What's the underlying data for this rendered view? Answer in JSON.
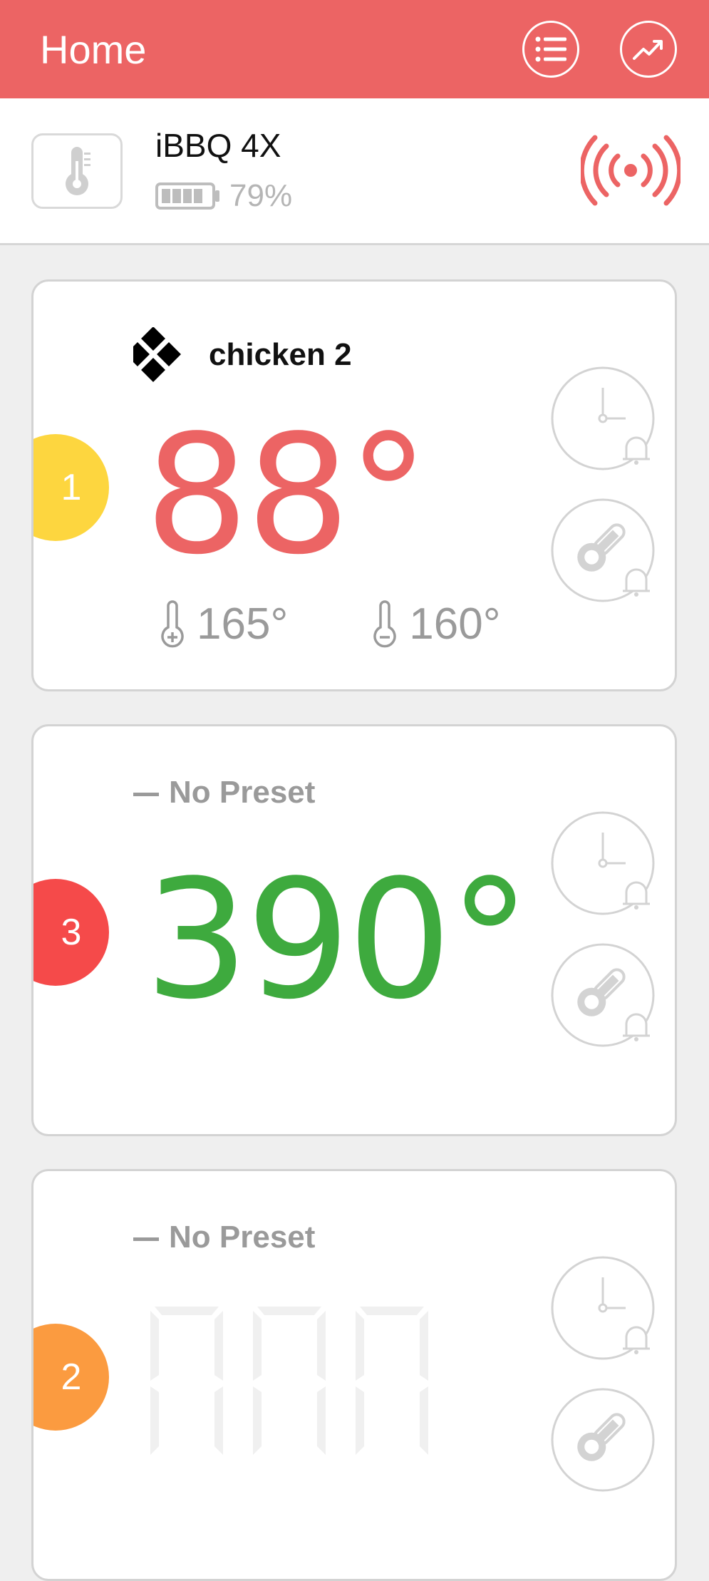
{
  "header": {
    "title": "Home",
    "background": "#ec6464"
  },
  "device": {
    "name": "iBBQ 4X",
    "battery_percent": "79%",
    "battery_level": 0.79,
    "signal_color": "#ec6464"
  },
  "probes": [
    {
      "number": "1",
      "badge_color": "#fdd63f",
      "preset_icon": "food-diamond-icon",
      "preset_name": "chicken 2",
      "temperature": "88°",
      "temperature_color": "#ec6464",
      "target_high": "165°",
      "target_low": "160°"
    },
    {
      "number": "3",
      "badge_color": "#f54a4a",
      "preset_name": "No Preset",
      "temperature": "390°",
      "temperature_color": "#3eaa3e"
    },
    {
      "number": "2",
      "badge_color": "#fb9b40",
      "preset_name": "No Preset"
    }
  ]
}
